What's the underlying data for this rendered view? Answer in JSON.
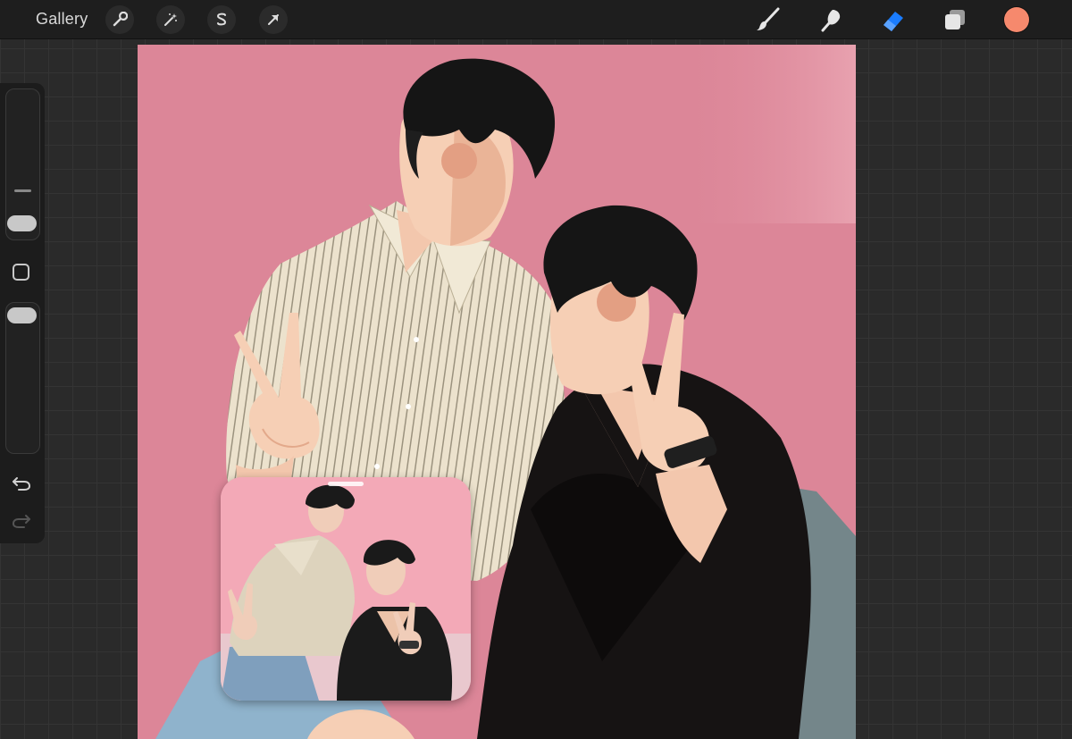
{
  "topbar": {
    "gallery_label": "Gallery",
    "left_tools": [
      "wrench-icon",
      "magic-wand-icon",
      "selection-s-icon",
      "transform-arrow-icon"
    ],
    "right_tools": [
      "brush-icon",
      "smudge-icon",
      "eraser-icon",
      "layers-icon"
    ],
    "active_tool": "eraser-icon",
    "accent_color": "#1a7cff",
    "current_color": "#f6896d"
  },
  "sidebar": {
    "tools": [
      "brush-size-slider",
      "modify-button",
      "opacity-slider",
      "undo-icon",
      "redo-icon"
    ]
  },
  "canvas": {
    "background_color": "#dc8698",
    "shadow_color": "#74868a",
    "shirt_color": "#ece2cd",
    "jacket_color": "#161313",
    "skin_color": "#f6cfb5",
    "blush_color": "#e39f83",
    "hair_color": "#151515"
  },
  "reference_window": {
    "content": "reference-photo"
  }
}
